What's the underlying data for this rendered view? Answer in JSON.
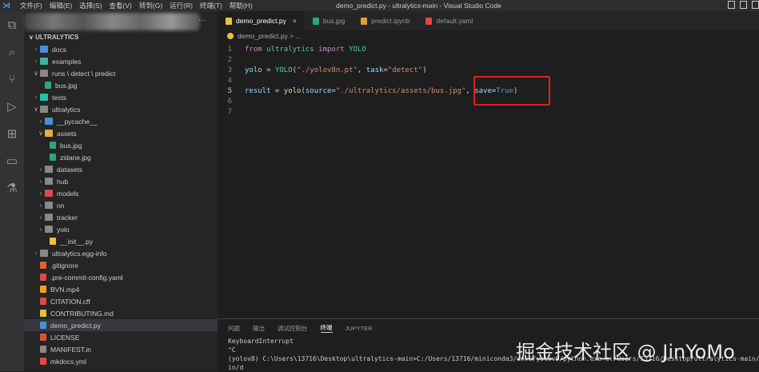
{
  "titlebar": {
    "menu": [
      "文件(F)",
      "编辑(E)",
      "选择(S)",
      "查看(V)",
      "转到(G)",
      "运行(R)",
      "终端(T)",
      "帮助(H)"
    ],
    "title": "demo_predict.py - ultralytics-main - Visual Studio Code"
  },
  "sidebar": {
    "section": "ULTRALYTICS",
    "more": "···",
    "items": [
      {
        "label": "docs",
        "level": 0,
        "type": "folder",
        "open": false,
        "color": "#4a90d9"
      },
      {
        "label": "examples",
        "level": 0,
        "type": "folder",
        "open": false,
        "color": "#3fb5a0"
      },
      {
        "label": "runs \\ detect \\ predict",
        "level": 0,
        "type": "folder",
        "open": true,
        "color": "#888888"
      },
      {
        "label": "bus.jpg",
        "level": 1,
        "type": "file",
        "color": "#2fa57a"
      },
      {
        "label": "tests",
        "level": 0,
        "type": "folder",
        "open": false,
        "color": "#22c5a0"
      },
      {
        "label": "ultralytics",
        "level": 0,
        "type": "folder",
        "open": true,
        "color": "#888888"
      },
      {
        "label": "__pycache__",
        "level": 1,
        "type": "folder",
        "open": false,
        "color": "#4a90d9"
      },
      {
        "label": "assets",
        "level": 1,
        "type": "folder",
        "open": true,
        "color": "#e0b040"
      },
      {
        "label": "bus.jpg",
        "level": 2,
        "type": "file",
        "color": "#2fa57a"
      },
      {
        "label": "zidane.jpg",
        "level": 2,
        "type": "file",
        "color": "#2fa57a"
      },
      {
        "label": "datasets",
        "level": 1,
        "type": "folder",
        "open": false,
        "color": "#888888"
      },
      {
        "label": "hub",
        "level": 1,
        "type": "folder",
        "open": false,
        "color": "#888888"
      },
      {
        "label": "models",
        "level": 1,
        "type": "folder",
        "open": false,
        "color": "#e04848"
      },
      {
        "label": "nn",
        "level": 1,
        "type": "folder",
        "open": false,
        "color": "#888888"
      },
      {
        "label": "tracker",
        "level": 1,
        "type": "folder",
        "open": false,
        "color": "#888888"
      },
      {
        "label": "yolo",
        "level": 1,
        "type": "folder",
        "open": false,
        "color": "#888888"
      },
      {
        "label": "__init__.py",
        "level": 2,
        "type": "file",
        "color": "#f0c040"
      },
      {
        "label": "ultralytics.egg-info",
        "level": 0,
        "type": "folder",
        "open": false,
        "color": "#888888"
      },
      {
        "label": ".gitignore",
        "level": 1,
        "type": "file",
        "color": "#e06030"
      },
      {
        "label": ".pre-commit-config.yaml",
        "level": 1,
        "type": "file",
        "color": "#e04848"
      },
      {
        "label": "BVN.mp4",
        "level": 1,
        "type": "file",
        "color": "#f0a020"
      },
      {
        "label": "CITATION.cff",
        "level": 1,
        "type": "file",
        "color": "#e04848"
      },
      {
        "label": "CONTRIBUTING.md",
        "level": 1,
        "type": "file",
        "color": "#e0c040"
      },
      {
        "label": "demo_predict.py",
        "level": 1,
        "type": "file",
        "color": "#4a90d9",
        "selected": true
      },
      {
        "label": "LICENSE",
        "level": 1,
        "type": "file",
        "color": "#e05030"
      },
      {
        "label": "MANIFEST.in",
        "level": 1,
        "type": "file",
        "color": "#888888"
      },
      {
        "label": "mkdocs.yml",
        "level": 1,
        "type": "file",
        "color": "#e04848"
      }
    ]
  },
  "tabs": [
    {
      "label": "demo_predict.py",
      "active": true,
      "color": "#f0c040"
    },
    {
      "label": "bus.jpg",
      "color": "#2fa57a"
    },
    {
      "label": "predict.ipynb",
      "color": "#e0a030"
    },
    {
      "label": "default.yaml",
      "color": "#e04848"
    }
  ],
  "breadcrumb": "demo_predict.py > ...",
  "code": {
    "current_line": 5,
    "lines": [
      [
        [
          "kw",
          "from"
        ],
        [
          "op",
          " "
        ],
        [
          "cls",
          "ultralytics"
        ],
        [
          "op",
          " "
        ],
        [
          "kw",
          "import"
        ],
        [
          "op",
          " "
        ],
        [
          "cls",
          "YOLO"
        ]
      ],
      [],
      [
        [
          "var",
          "yolo"
        ],
        [
          "op",
          " = "
        ],
        [
          "cls",
          "YOLO"
        ],
        [
          "op",
          "("
        ],
        [
          "str",
          "\"./yolov8n.pt\""
        ],
        [
          "op",
          ", "
        ],
        [
          "var",
          "task"
        ],
        [
          "op",
          "="
        ],
        [
          "str",
          "\"detect\""
        ],
        [
          "op",
          ")"
        ]
      ],
      [],
      [
        [
          "var",
          "result"
        ],
        [
          "op",
          " = "
        ],
        [
          "fn",
          "yolo"
        ],
        [
          "op",
          "("
        ],
        [
          "var",
          "source"
        ],
        [
          "op",
          "="
        ],
        [
          "str",
          "\"./ultralytics/assets/bus.jpg\""
        ],
        [
          "op",
          ", "
        ],
        [
          "var",
          "save"
        ],
        [
          "op",
          "="
        ],
        [
          "bool",
          "True"
        ],
        [
          "op",
          ")"
        ]
      ],
      [],
      []
    ]
  },
  "panel": {
    "tabs": [
      "问题",
      "输出",
      "调试控制台",
      "终端",
      "JUPYTER"
    ],
    "active": 3,
    "terminal": [
      "KeyboardInterrupt",
      "^C",
      "(yolov8) C:\\Users\\13716\\Desktop\\ultralytics-main>C:/Users/13716/miniconda3/envs/yolov8/python.exe c:/Users/13716/Desktop/ultralytics-main/",
      "in/d"
    ]
  },
  "watermark": "掘金技术社区 @ JinYoMo"
}
